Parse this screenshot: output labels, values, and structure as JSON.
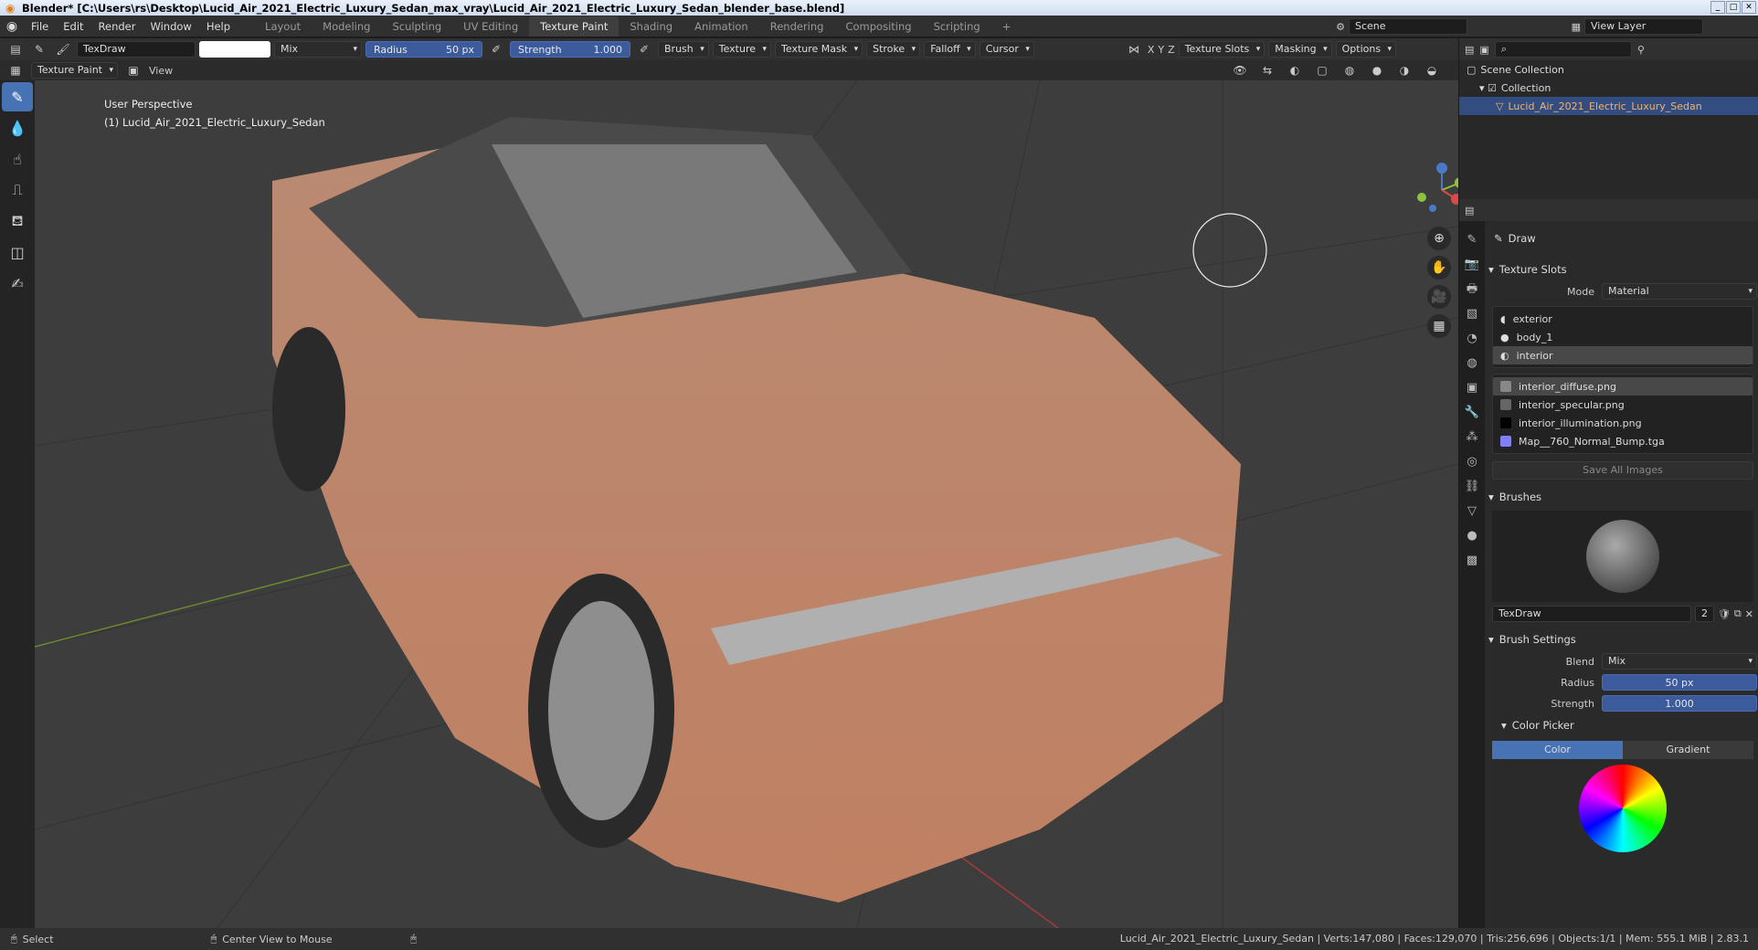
{
  "window": {
    "title": "Blender* [C:\\Users\\rs\\Desktop\\Lucid_Air_2021_Electric_Luxury_Sedan_max_vray\\Lucid_Air_2021_Electric_Luxury_Sedan_blender_base.blend]"
  },
  "menu": [
    "File",
    "Edit",
    "Render",
    "Window",
    "Help"
  ],
  "workspaces": [
    "Layout",
    "Modeling",
    "Sculpting",
    "UV Editing",
    "Texture Paint",
    "Shading",
    "Animation",
    "Rendering",
    "Compositing",
    "Scripting"
  ],
  "active_workspace": "Texture Paint",
  "scene": "Scene",
  "view_layer": "View Layer",
  "tool_header": {
    "brush_name": "TexDraw",
    "blend": "Mix",
    "radius_label": "Radius",
    "radius_value": "50 px",
    "strength_label": "Strength",
    "strength_value": "1.000",
    "brush": "Brush",
    "texture": "Texture",
    "texture_mask": "Texture Mask",
    "stroke": "Stroke",
    "falloff": "Falloff",
    "cursor": "Cursor",
    "axes": [
      "X",
      "Y",
      "Z"
    ],
    "texture_slots": "Texture Slots",
    "masking": "Masking",
    "options": "Options"
  },
  "header2": {
    "mode": "Texture Paint",
    "view": "View"
  },
  "viewport": {
    "perspective": "User Perspective",
    "object": "(1) Lucid_Air_2021_Electric_Luxury_Sedan"
  },
  "outliner": {
    "scene_collection": "Scene Collection",
    "collection": "Collection",
    "object": "Lucid_Air_2021_Electric_Luxury_Sedan"
  },
  "properties": {
    "tool": "Draw",
    "texture_slots": {
      "title": "Texture Slots",
      "mode_label": "Mode",
      "mode_value": "Material",
      "materials": [
        "exterior",
        "body_1",
        "interior"
      ],
      "images": [
        "interior_diffuse.png",
        "interior_specular.png",
        "interior_illumination.png",
        "Map__760_Normal_Bump.tga"
      ],
      "save": "Save All Images"
    },
    "brushes": {
      "title": "Brushes",
      "name": "TexDraw",
      "users": "2"
    },
    "brush_settings": {
      "title": "Brush Settings",
      "blend_label": "Blend",
      "blend_value": "Mix",
      "radius_label": "Radius",
      "radius_value": "50 px",
      "strength_label": "Strength",
      "strength_value": "1.000"
    },
    "color_picker": {
      "title": "Color Picker",
      "tab_color": "Color",
      "tab_gradient": "Gradient"
    }
  },
  "status": {
    "select": "Select",
    "center": "Center View to Mouse",
    "stats": "Lucid_Air_2021_Electric_Luxury_Sedan | Verts:147,080 | Faces:129,070 | Tris:256,696 | Objects:1/1 | Mem: 555.1 MiB | 2.83.1"
  }
}
